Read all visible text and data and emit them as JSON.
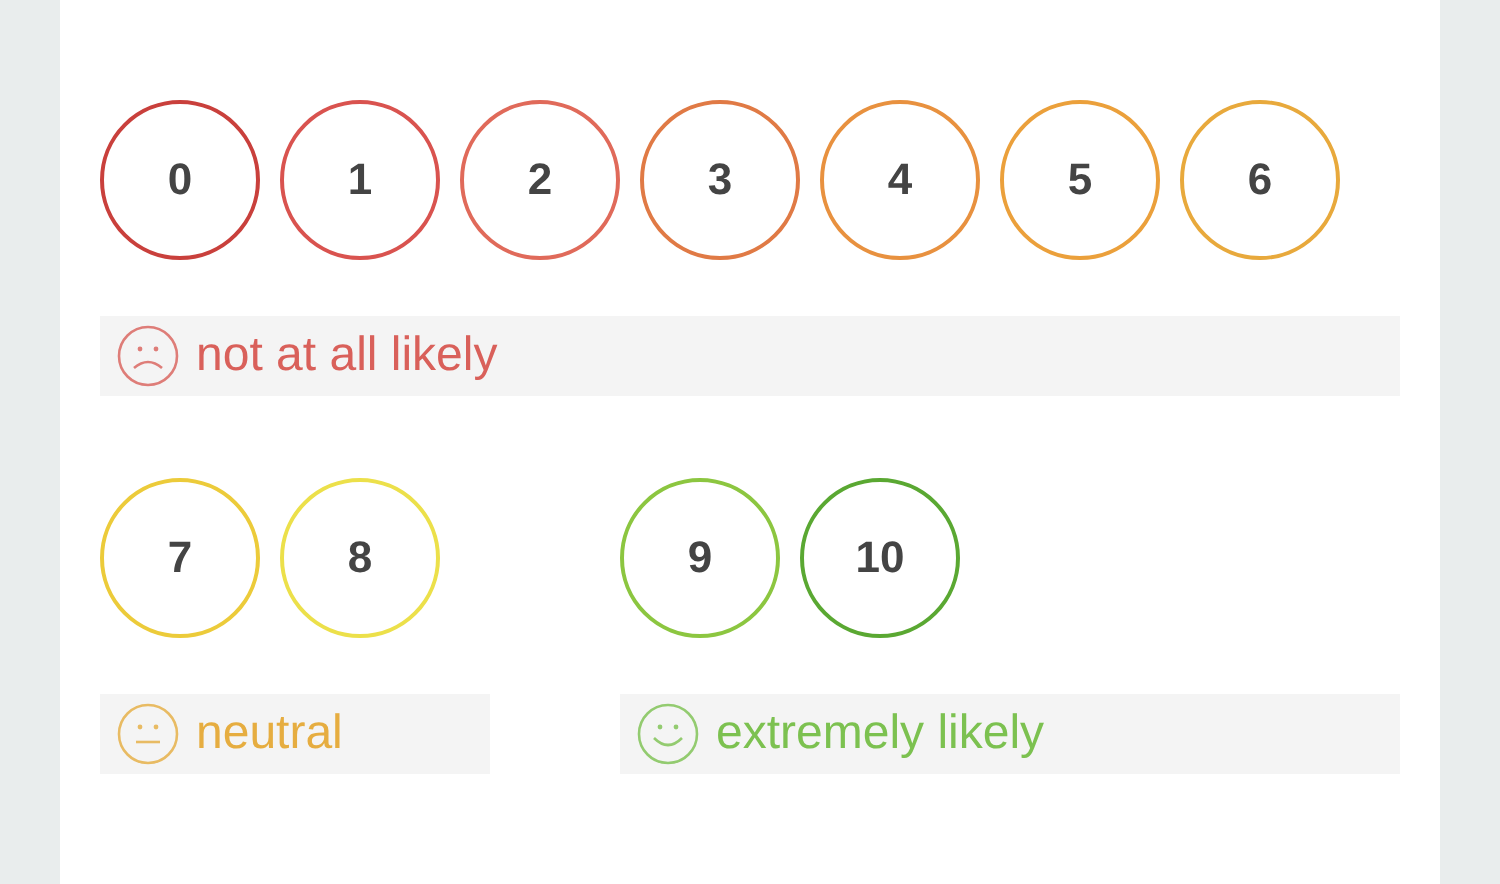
{
  "groups": [
    {
      "kind": "sad",
      "label": "not at all likely",
      "color": "#d9605a",
      "options": [
        {
          "label": "0",
          "color": "#c9403c"
        },
        {
          "label": "1",
          "color": "#d9534f"
        },
        {
          "label": "2",
          "color": "#e06a5a"
        },
        {
          "label": "3",
          "color": "#e07a45"
        },
        {
          "label": "4",
          "color": "#e8913f"
        },
        {
          "label": "5",
          "color": "#eba03b"
        },
        {
          "label": "6",
          "color": "#e8a93c"
        }
      ]
    },
    {
      "kind": "neutral",
      "label": "neutral",
      "color": "#e6ad40",
      "options": [
        {
          "label": "7",
          "color": "#eccb3a"
        },
        {
          "label": "8",
          "color": "#ece04a"
        }
      ]
    },
    {
      "kind": "happy",
      "label": "extremely likely",
      "color": "#7cc150",
      "options": [
        {
          "label": "9",
          "color": "#8cc640"
        },
        {
          "label": "10",
          "color": "#5aa832"
        }
      ]
    }
  ]
}
